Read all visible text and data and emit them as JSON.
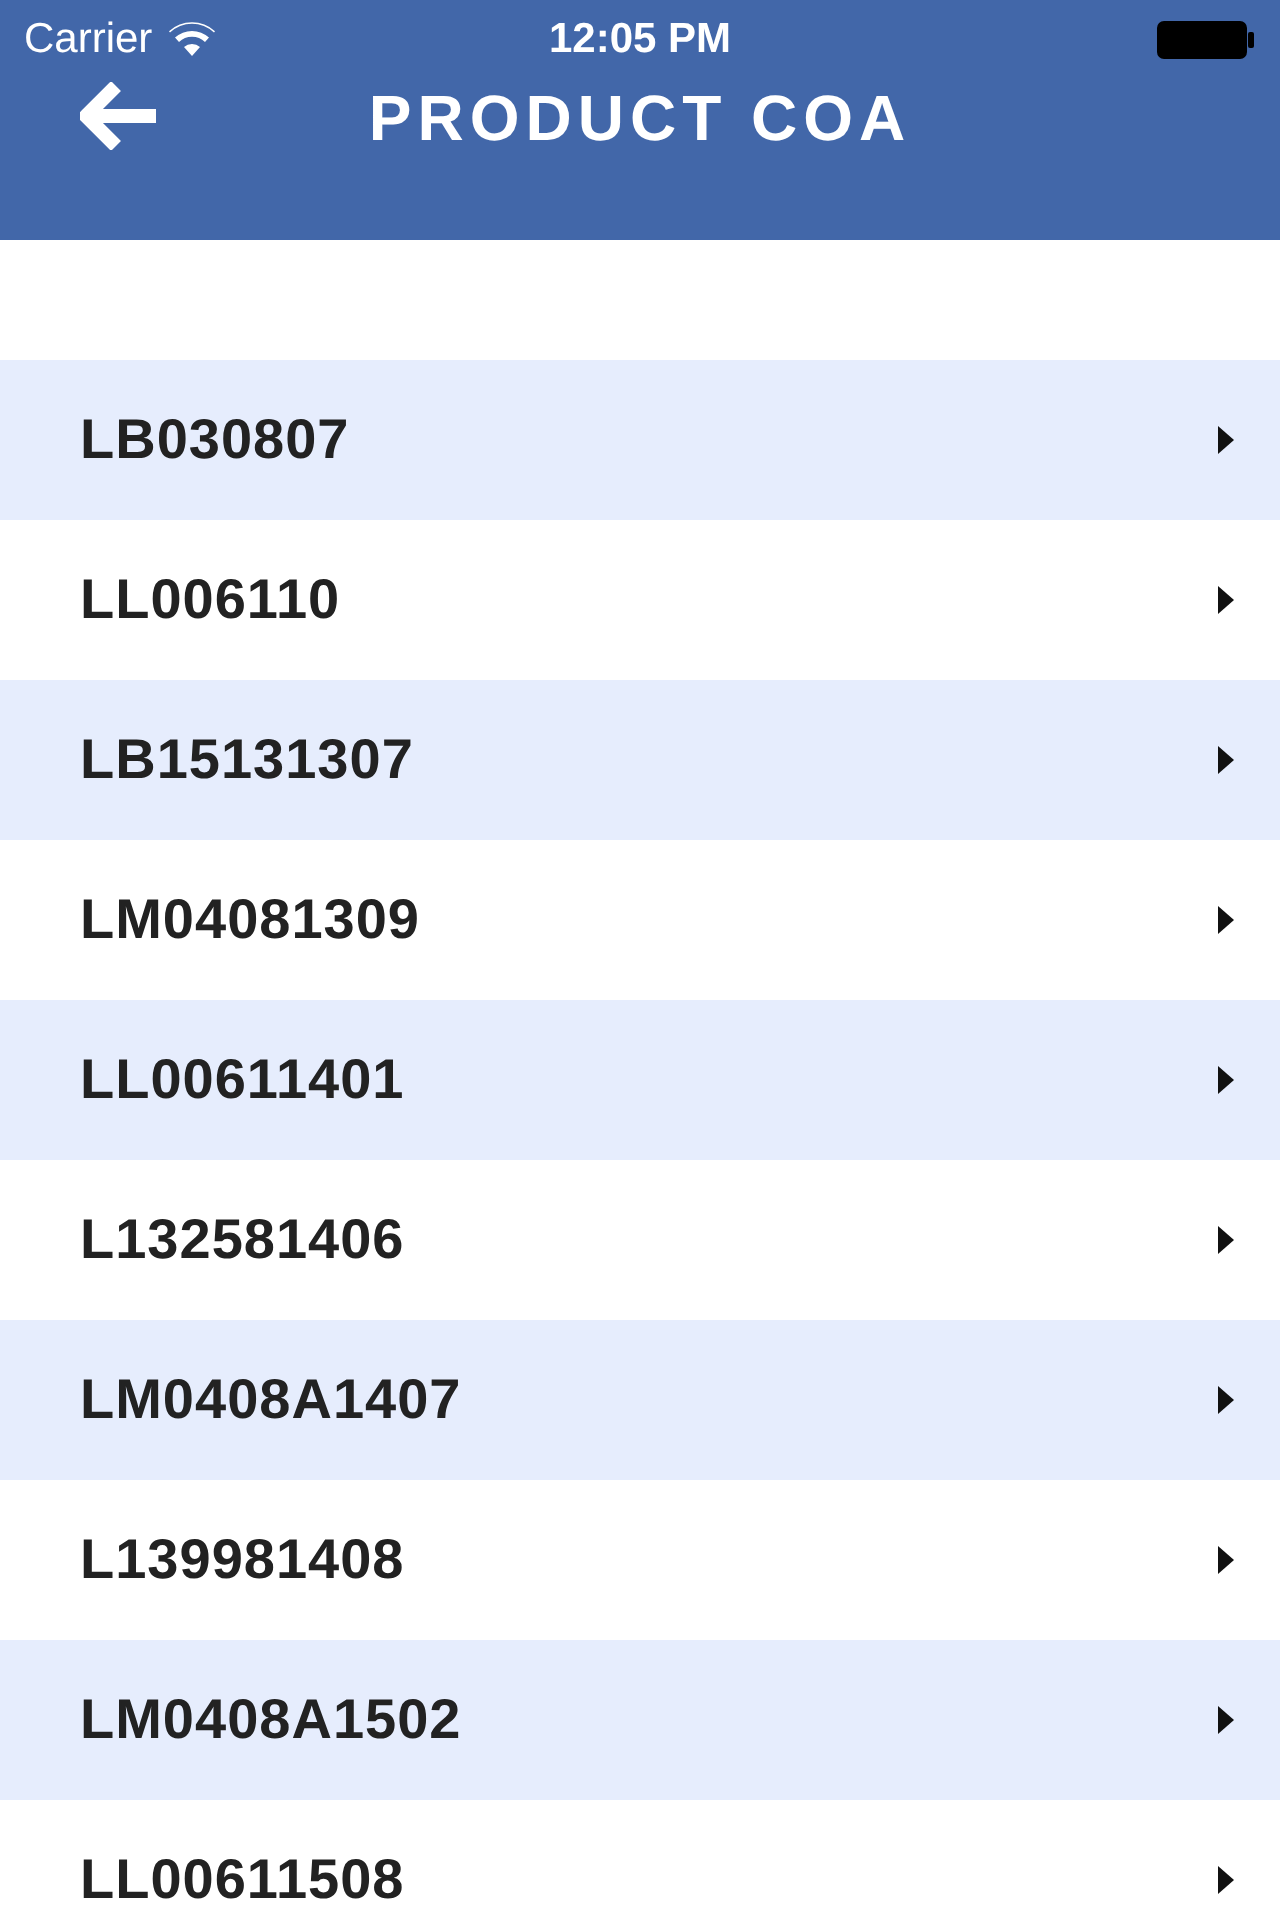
{
  "status_bar": {
    "carrier": "Carrier",
    "time": "12:05 PM"
  },
  "header": {
    "title": "PRODUCT COA"
  },
  "items": [
    {
      "label": "LB030807"
    },
    {
      "label": "LL006110"
    },
    {
      "label": "LB15131307"
    },
    {
      "label": "LM04081309"
    },
    {
      "label": "LL00611401"
    },
    {
      "label": "L132581406"
    },
    {
      "label": "LM0408A1407"
    },
    {
      "label": "L139981408"
    },
    {
      "label": "LM0408A1502"
    },
    {
      "label": "LL00611508"
    }
  ]
}
